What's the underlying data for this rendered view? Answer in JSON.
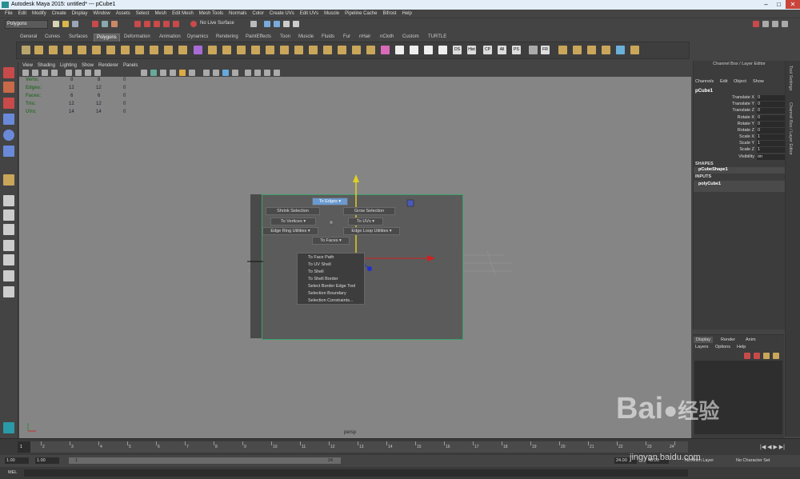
{
  "titlebar": {
    "title": "Autodesk Maya 2015: untitled*   ---   pCube1"
  },
  "menubar": {
    "items": [
      "File",
      "Edit",
      "Modify",
      "Create",
      "Display",
      "Window",
      "Assets",
      "Select",
      "Mesh",
      "Edit Mesh",
      "Mesh Tools",
      "Normals",
      "Color",
      "Create UVs",
      "Edit UVs",
      "Muscle",
      "Pipeline Cache",
      "Bifrost",
      "Help"
    ]
  },
  "statusline": {
    "mode": "Polygons",
    "live_surface": "No Live Surface"
  },
  "shelf": {
    "tabs": [
      "General",
      "Curves",
      "Surfaces",
      "Polygons",
      "Deformation",
      "Animation",
      "Dynamics",
      "Rendering",
      "PaintEffects",
      "Toon",
      "Muscle",
      "Fluids",
      "Fur",
      "nHair",
      "nCloth",
      "Custom",
      "TURTLE"
    ],
    "active_tab": "Polygons",
    "text_icons": [
      "DS",
      "Hist",
      "CP",
      "All",
      "PS",
      "FR"
    ]
  },
  "panel": {
    "menu": [
      "View",
      "Shading",
      "Lighting",
      "Show",
      "Renderer",
      "Panels"
    ],
    "camera_label": "persp"
  },
  "hud": {
    "rows": [
      {
        "label": "Verts:",
        "v1": "8",
        "v2": "8",
        "v3": "0"
      },
      {
        "label": "Edges:",
        "v1": "12",
        "v2": "12",
        "v3": "0"
      },
      {
        "label": "Faces:",
        "v1": "6",
        "v2": "6",
        "v3": "0"
      },
      {
        "label": "Tris:",
        "v1": "12",
        "v2": "12",
        "v3": "0"
      },
      {
        "label": "UVs:",
        "v1": "14",
        "v2": "14",
        "v3": "0"
      }
    ]
  },
  "marking_menu": {
    "to_edges": "To Edges",
    "shrink": "Shrink Selection",
    "grow": "Grow Selection",
    "to_vertices": "To Vertices",
    "to_uvs": "To UVs",
    "edge_ring": "Edge Ring Utilities",
    "edge_loop": "Edge Loop Utilities",
    "to_faces": "To Faces",
    "submenu": [
      "To Face Path",
      "To UV Shell",
      "To Shell",
      "To Shell Border",
      "Select Border Edge Tool",
      "Selection Boundary",
      "Selection Constraints..."
    ]
  },
  "channel_box": {
    "title": "Channel Box / Layer Editor",
    "menu": [
      "Channels",
      "Edit",
      "Object",
      "Show"
    ],
    "object": "pCube1",
    "attributes": [
      {
        "name": "Translate X",
        "value": "0"
      },
      {
        "name": "Translate Y",
        "value": "0"
      },
      {
        "name": "Translate Z",
        "value": "0"
      },
      {
        "name": "Rotate X",
        "value": "0"
      },
      {
        "name": "Rotate Y",
        "value": "0"
      },
      {
        "name": "Rotate Z",
        "value": "0"
      },
      {
        "name": "Scale X",
        "value": "1"
      },
      {
        "name": "Scale Y",
        "value": "1"
      },
      {
        "name": "Scale Z",
        "value": "1"
      },
      {
        "name": "Visibility",
        "value": "on"
      }
    ],
    "shapes_label": "SHAPES",
    "shape": "pCubeShape1",
    "inputs_label": "INPUTS",
    "input": "polyCube1"
  },
  "side_tabs": [
    "Tool Settings",
    "Channel Box / Layer Editor"
  ],
  "layer_editor": {
    "tabs": [
      "Display",
      "Render",
      "Anim"
    ],
    "menu": [
      "Layers",
      "Options",
      "Help"
    ]
  },
  "time_slider": {
    "ticks": [
      "1",
      "2",
      "3",
      "4",
      "5",
      "6",
      "7",
      "8",
      "9",
      "10",
      "11",
      "12",
      "13",
      "14",
      "15",
      "16",
      "17",
      "18",
      "19",
      "20",
      "21",
      "22",
      "23",
      "24"
    ],
    "current": "1"
  },
  "range": {
    "start": "1.00",
    "playback_start": "1.00",
    "range_start": "1",
    "range_end": "24",
    "playback_end": "24.00",
    "end": "48.00",
    "anim_layer": "No Anim Layer",
    "char_set": "No Character Set"
  },
  "mel": {
    "label": "MEL"
  },
  "watermark": {
    "brand": "Bai",
    "brand_cn": "经验",
    "url": "jingyan.baidu.com"
  },
  "colors": {
    "accent": "#6a9ad0",
    "cube_edge": "#3aa06a",
    "viewport_bg": "#858585"
  }
}
